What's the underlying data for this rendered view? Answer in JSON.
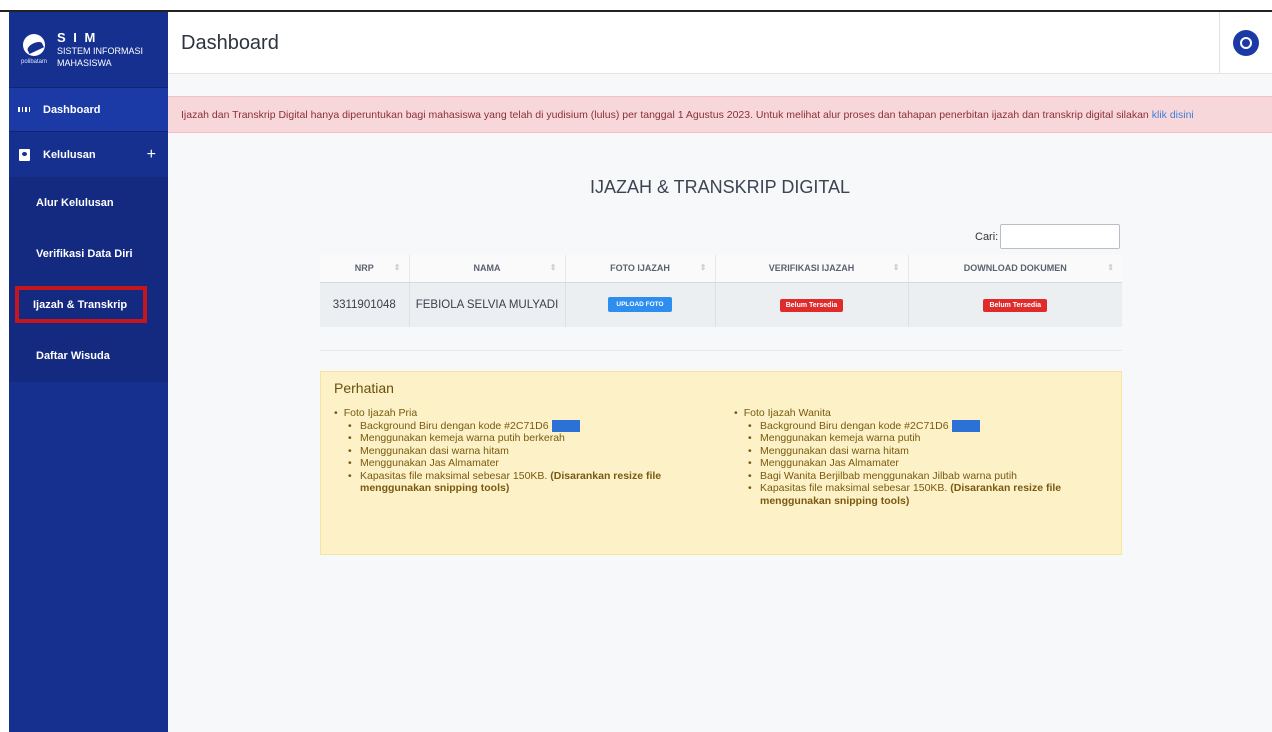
{
  "brand": {
    "title": "S I M",
    "sub1": "SISTEM INFORMASI",
    "sub2": "MAHASISWA",
    "logo_text": "polibatam"
  },
  "sidebar": {
    "dashboard": "Dashboard",
    "kelulusan": "Kelulusan",
    "kelulusan_toggle": "+",
    "submenu": [
      "Alur Kelulusan",
      "Verifikasi Data Diri",
      "Ijazah & Transkrip",
      "Daftar Wisuda"
    ]
  },
  "header": {
    "title": "Dashboard"
  },
  "alert": {
    "text": "Ijazah dan Transkrip Digital hanya diperuntukan bagi mahasiswa yang telah di yudisium (lulus) per tanggal 1 Agustus 2023. Untuk melihat alur proses dan tahapan penerbitan ijazah dan transkrip digital silakan",
    "link": "klik disini"
  },
  "main": {
    "title": "IJAZAH & TRANSKRIP DIGITAL",
    "search_label": "Cari:",
    "search_value": ""
  },
  "table": {
    "headers": [
      "NRP",
      "NAMA",
      "FOTO IJAZAH",
      "VERIFIKASI IJAZAH",
      "DOWNLOAD DOKUMEN"
    ],
    "rows": [
      {
        "nrp": "3311901048",
        "nama": "FEBIOLA SELVIA MULYADI",
        "foto": "UPLOAD FOTO",
        "verifikasi": "Belum Tersedia",
        "download": "Belum Tersedia"
      }
    ]
  },
  "notice": {
    "title": "Perhatian",
    "pria": {
      "heading": "Foto Ijazah Pria",
      "items": [
        "Background Biru dengan kode #2C71D6",
        "Menggunakan kemeja warna putih berkerah",
        "Menggunakan dasi warna hitam",
        "Menggunakan Jas Almamater"
      ],
      "size_text": "Kapasitas file maksimal sebesar 150KB.",
      "size_bold": "(Disarankan resize file menggunakan snipping tools)"
    },
    "wanita": {
      "heading": "Foto Ijazah Wanita",
      "items": [
        "Background Biru dengan kode #2C71D6",
        "Menggunakan kemeja warna putih",
        "Menggunakan dasi warna hitam",
        "Menggunakan Jas Almamater",
        "Bagi Wanita Berjilbab menggunakan Jilbab warna putih"
      ],
      "size_text": "Kapasitas file maksimal sebesar 150KB.",
      "size_bold": "(Disarankan resize file menggunakan snipping tools)"
    }
  },
  "colors": {
    "sidebar": "#15308f",
    "swatch": "#2C71D6",
    "alert_bg": "#f8d7da",
    "notice_bg": "#fcf1c7",
    "badge_red": "#e02b2b",
    "upload_blue": "#2d8ef0",
    "active_outline": "#c4161c"
  }
}
